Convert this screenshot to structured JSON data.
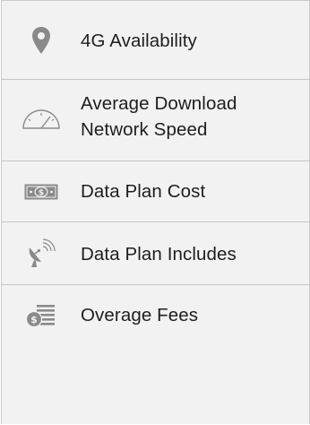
{
  "menu": {
    "items": [
      {
        "label": "4G Availability",
        "icon": "location-pin-icon"
      },
      {
        "label": "Average Download Network Speed",
        "icon": "speedometer-icon"
      },
      {
        "label": "Data Plan Cost",
        "icon": "dollar-bill-icon"
      },
      {
        "label": "Data Plan Includes",
        "icon": "satellite-dish-icon"
      },
      {
        "label": "Overage Fees",
        "icon": "fee-list-icon"
      }
    ]
  },
  "colors": {
    "panel_background": "#f2f2f2",
    "divider": "#c4c4c4",
    "icon": "#8a8a8a",
    "text": "#1e1e1e"
  }
}
